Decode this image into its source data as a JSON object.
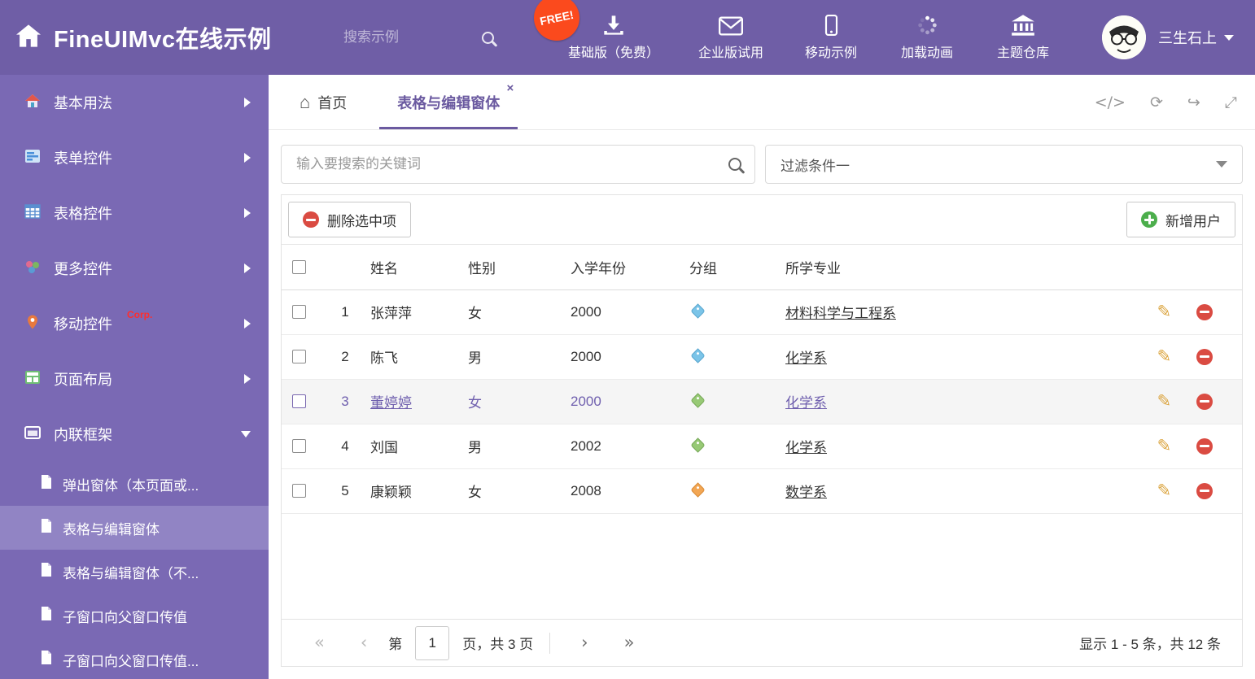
{
  "colors": {
    "header_bg": "#6f5ea6",
    "sidebar_bg": "#7a69b4",
    "accent_purple": "#6b5aa0",
    "free_badge_bg": "#fb4a1d",
    "delete_red": "#da4b42",
    "add_green": "#4cae4c",
    "pencil_orange": "#dba43e",
    "tag_blue": "#7bc4e8",
    "tag_green": "#97c975",
    "tag_orange": "#f2a654"
  },
  "icons": {
    "code": "</>",
    "refresh": "⟳",
    "forward": "↪",
    "expand": "⤢",
    "home_tab": "⌂",
    "close": "×",
    "edit": "✎",
    "first": "«",
    "prev": "‹",
    "next": "›",
    "last": "»"
  },
  "header": {
    "title": "FineUIMvc在线示例",
    "search_placeholder": "搜索示例",
    "free_badge": "FREE!",
    "nav": [
      {
        "label": "基础版（免费）",
        "icon": "download-icon"
      },
      {
        "label": "企业版试用",
        "icon": "envelope-icon"
      },
      {
        "label": "移动示例",
        "icon": "mobile-icon"
      },
      {
        "label": "加载动画",
        "icon": "spinner-icon"
      },
      {
        "label": "主题仓库",
        "icon": "bank-icon"
      }
    ],
    "user": {
      "name": "三生石上"
    }
  },
  "sidebar": {
    "items": [
      {
        "label": "基本用法",
        "icon": "home-icon"
      },
      {
        "label": "表单控件",
        "icon": "form-icon"
      },
      {
        "label": "表格控件",
        "icon": "table-icon"
      },
      {
        "label": "更多控件",
        "icon": "controls-icon"
      },
      {
        "label": "移动控件",
        "icon": "mobile-pin-icon",
        "badge": "Corp."
      },
      {
        "label": "页面布局",
        "icon": "layout-icon"
      },
      {
        "label": "内联框架",
        "icon": "frame-icon",
        "expanded": "true"
      }
    ],
    "subitems": [
      {
        "label": "弹出窗体（本页面或..."
      },
      {
        "label": "表格与编辑窗体",
        "active": "true"
      },
      {
        "label": "表格与编辑窗体（不..."
      },
      {
        "label": "子窗口向父窗口传值"
      },
      {
        "label": "子窗口向父窗口传值..."
      }
    ]
  },
  "tabbar": {
    "tabs": [
      {
        "label": "首页",
        "icon": "home-icon"
      },
      {
        "label": "表格与编辑窗体",
        "active": "true",
        "closable": "true"
      }
    ]
  },
  "filters": {
    "search_placeholder": "输入要搜索的关键词",
    "filter_value": "过滤条件一"
  },
  "toolbar": {
    "delete_label": "删除选中项",
    "add_label": "新增用户"
  },
  "table": {
    "columns": [
      "姓名",
      "性别",
      "入学年份",
      "分组",
      "所学专业"
    ],
    "rows": [
      {
        "num": "1",
        "name": "张萍萍",
        "gender": "女",
        "year": "2000",
        "tag": "blue",
        "major": "材料科学与工程系"
      },
      {
        "num": "2",
        "name": "陈飞",
        "gender": "男",
        "year": "2000",
        "tag": "blue",
        "major": "化学系"
      },
      {
        "num": "3",
        "name": "董婷婷",
        "gender": "女",
        "year": "2000",
        "tag": "green",
        "major": "化学系",
        "selected": "true"
      },
      {
        "num": "4",
        "name": "刘国",
        "gender": "男",
        "year": "2002",
        "tag": "green",
        "major": "化学系"
      },
      {
        "num": "5",
        "name": "康颖颖",
        "gender": "女",
        "year": "2008",
        "tag": "orange",
        "major": "数学系"
      }
    ]
  },
  "pagination": {
    "page_prefix": "第",
    "page_value": "1",
    "page_suffix": "页，共 3 页",
    "summary": "显示 1 - 5 条，共 12 条"
  }
}
